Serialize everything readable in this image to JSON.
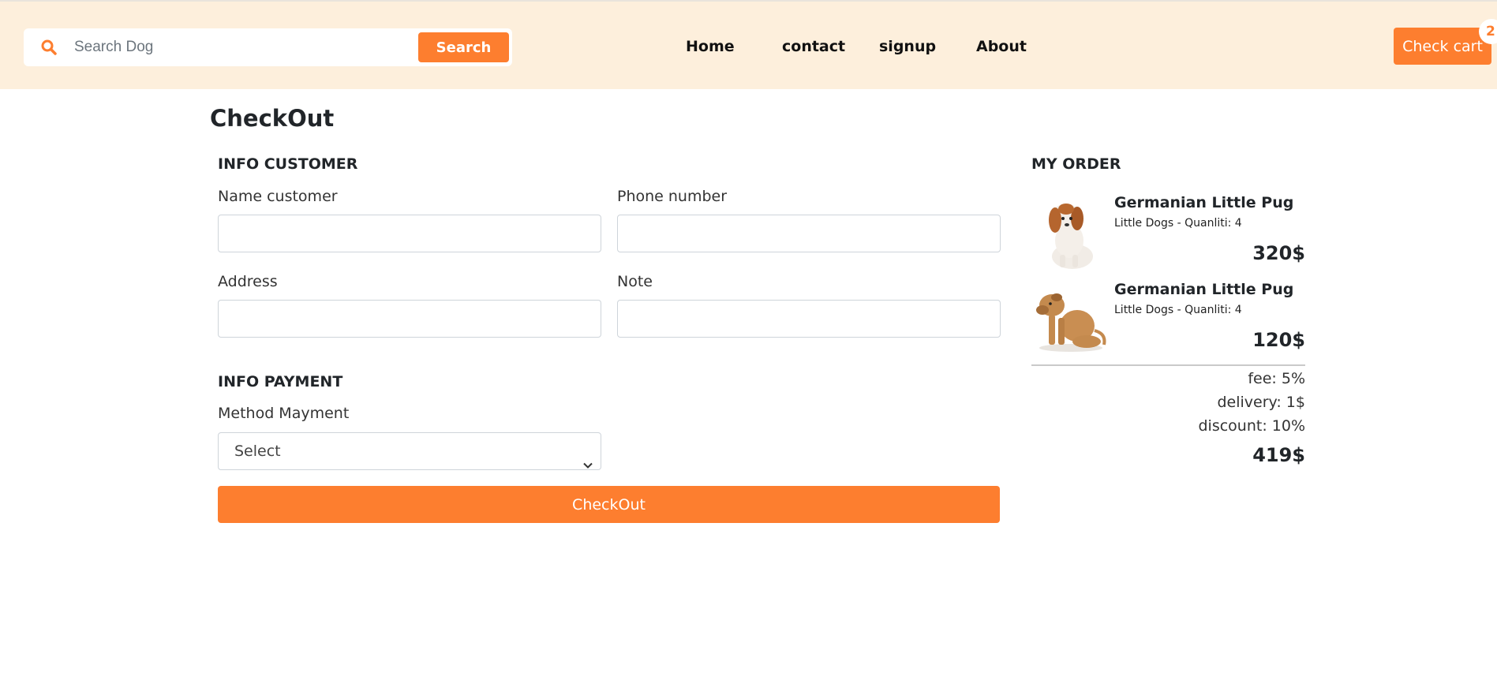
{
  "header": {
    "search_placeholder": "Search Dog",
    "search_button": "Search",
    "nav": [
      "Home",
      "contact",
      "signup",
      "About"
    ],
    "cart_button": "Check cart",
    "cart_count": "2"
  },
  "main": {
    "title": "CheckOut",
    "customer": {
      "section_title": "INFO CUSTOMER",
      "name_label": "Name customer",
      "phone_label": "Phone number",
      "address_label": "Address",
      "note_label": "Note"
    },
    "payment": {
      "section_title": "INFO PAYMENT",
      "method_label": "Method Mayment",
      "method_selected": "Select"
    },
    "checkout_button": "CheckOut"
  },
  "order": {
    "title": "MY ORDER",
    "items": [
      {
        "name": "Germanian Little Pug",
        "meta": "Little Dogs - Quanliti: 4",
        "price": "320$"
      },
      {
        "name": "Germanian Little Pug",
        "meta": "Little Dogs - Quanliti: 4",
        "price": "120$"
      }
    ],
    "fee": "fee: 5%",
    "delivery": "delivery: 1$",
    "discount": "discount: 10%",
    "total": "419$"
  },
  "colors": {
    "accent": "#fd7e2f",
    "header_bg": "#fdefdc"
  }
}
